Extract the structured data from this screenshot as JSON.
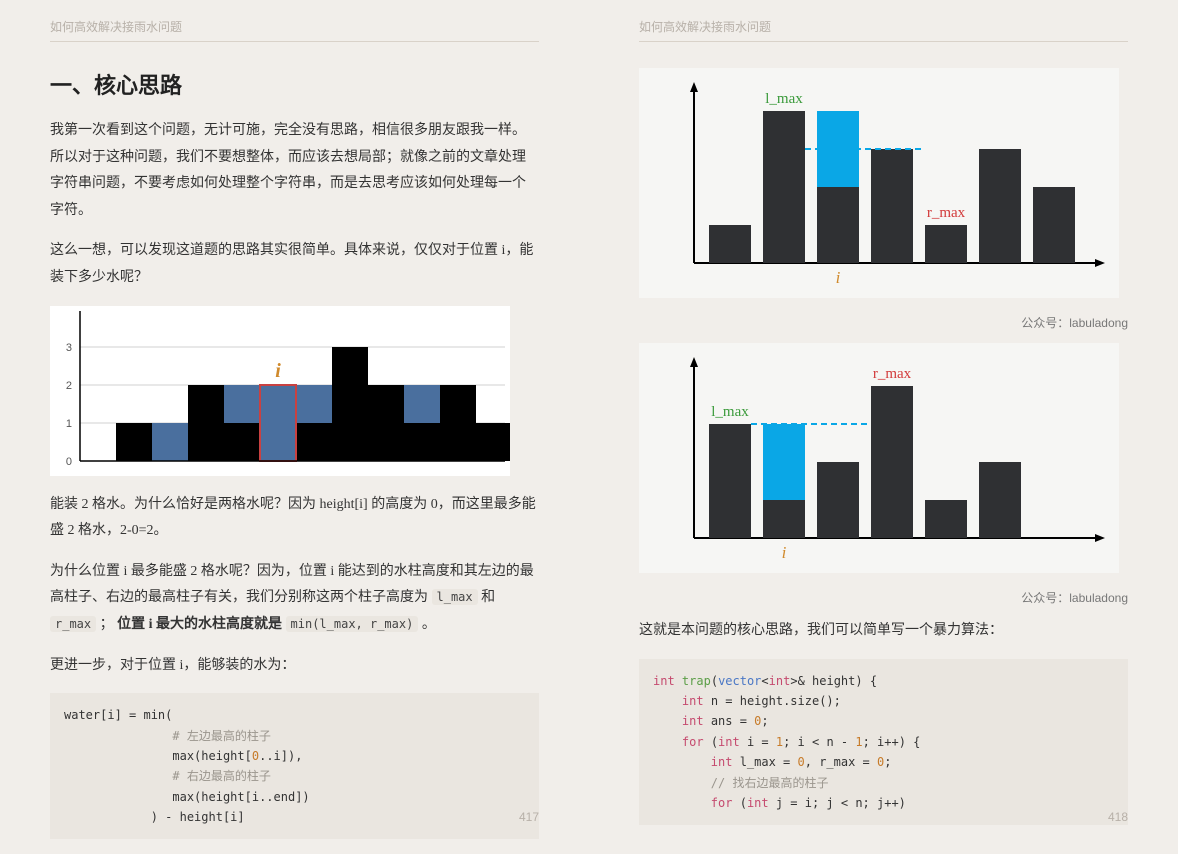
{
  "pages": {
    "left": {
      "header": "如何高效解决接雨水问题",
      "h1": "一、核心思路",
      "p1": "我第一次看到这个问题，无计可施，完全没有思路，相信很多朋友跟我一样。所以对于这种问题，我们不要想整体，而应该去想局部；就像之前的文章处理字符串问题，不要考虑如何处理整个字符串，而是去思考应该如何处理每一个字符。",
      "p2": "这么一想，可以发现这道题的思路其实很简单。具体来说，仅仅对于位置 i，能装下多少水呢？",
      "p3_a": "能装 2 格水。为什么恰好是两格水呢？因为 height[i] 的高度为 0，而这里最多能盛 2 格水，2-0=2。",
      "p4_a": "为什么位置 i 最多能盛 2 格水呢？因为，位置 i 能达到的水柱高度和其左边的最高柱子、右边的最高柱子有关，我们分别称这两个柱子高度为 ",
      "p4_code1": "l_max",
      "p4_b": " 和 ",
      "p4_code2": "r_max",
      "p4_c": " ；",
      "p4_bold": "位置 i 最大的水柱高度就是 ",
      "p4_code3": "min(l_max, r_max)",
      "p4_d": " 。",
      "p5": "更进一步，对于位置 i，能够装的水为：",
      "code1": {
        "l1": "water[i] = min(",
        "c1": "# 左边最高的柱子",
        "l2a": "max(height[",
        "l2b": "0",
        "l2c": "..i]),",
        "c2": "# 右边最高的柱子",
        "l3": "max(height[i..end])",
        "l4": ") - height[i]"
      },
      "page_num": "417"
    },
    "right": {
      "header": "如何高效解决接雨水问题",
      "credit1": "公众号：labuladong",
      "credit2": "公众号：labuladong",
      "p6": "这就是本问题的核心思路，我们可以简单写一个暴力算法：",
      "code2": {
        "l1a": "int",
        "l1b": " ",
        "l1c": "trap",
        "l1d": "(",
        "l1e": "vector",
        "l1f": "<",
        "l1g": "int",
        "l1h": ">& height) {",
        "l2a": "int",
        "l2b": " n = height.size();",
        "l3a": "int",
        "l3b": " ans = ",
        "l3c": "0",
        "l3d": ";",
        "l4a": "for",
        "l4b": " (",
        "l4c": "int",
        "l4d": " i = ",
        "l4e": "1",
        "l4f": "; i < n - ",
        "l4g": "1",
        "l4h": "; i++) {",
        "l5a": "int",
        "l5b": " l_max = ",
        "l5c": "0",
        "l5d": ", r_max = ",
        "l5e": "0",
        "l5f": ";",
        "l6": "// 找右边最高的柱子",
        "l7a": "for",
        "l7b": " (",
        "l7c": "int",
        "l7d": " j = i; j < n; j++)"
      },
      "page_num": "418"
    }
  },
  "chart_data": [
    {
      "id": "chart-left",
      "type": "bar",
      "y_ticks": [
        0,
        1,
        2,
        3
      ],
      "heights": [
        0,
        1,
        0,
        2,
        1,
        0,
        1,
        3,
        2,
        1,
        2,
        1
      ],
      "water": [
        0,
        0,
        1,
        0,
        1,
        2,
        1,
        0,
        0,
        1,
        0,
        0
      ],
      "highlight_index": 5,
      "label_i": "i",
      "bar_color": "#000",
      "water_color": "#4a6f9e"
    },
    {
      "id": "chart-top-right",
      "type": "bar",
      "heights": [
        1,
        4,
        2,
        3,
        1,
        3,
        2
      ],
      "water_pairs": [
        [
          2,
          4
        ]
      ],
      "l_max_idx": 1,
      "l_max_label": "l_max",
      "r_max_idx": 4,
      "r_max_label": "r_max",
      "i_idx": 2,
      "label_i": "i",
      "dash_level": 3,
      "bar_color": "#2f3033",
      "water_color": "#0aa7e6"
    },
    {
      "id": "chart-bottom-right",
      "type": "bar",
      "heights": [
        3,
        1,
        2,
        4,
        1,
        2
      ],
      "water_pairs": [
        [
          1,
          3
        ]
      ],
      "l_max_idx": 0,
      "l_max_label": "l_max",
      "r_max_idx": 3,
      "r_max_label": "r_max",
      "i_idx": 1,
      "label_i": "i",
      "dash_level": 3,
      "bar_color": "#2f3033",
      "water_color": "#0aa7e6"
    }
  ]
}
